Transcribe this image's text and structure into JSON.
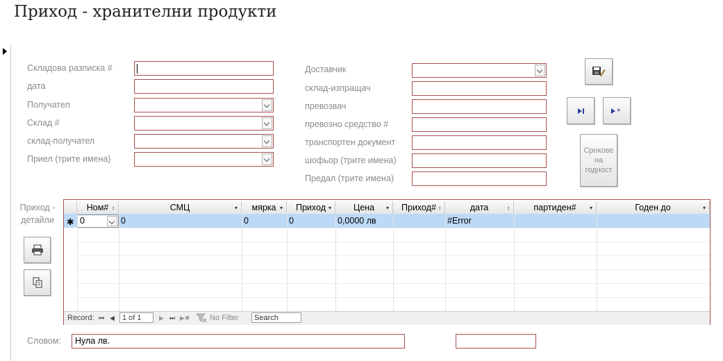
{
  "window": {
    "title": "Приход - хранителни продукти"
  },
  "left_fields": [
    {
      "label": "Складова разписка #",
      "value": "",
      "type": "text"
    },
    {
      "label": "дата",
      "value": "",
      "type": "text"
    },
    {
      "label": "Получател",
      "value": "",
      "type": "combo"
    },
    {
      "label": "Склад #",
      "value": "",
      "type": "combo"
    },
    {
      "label": "склад-получател",
      "value": "",
      "type": "combo"
    },
    {
      "label": "Приел (трите имена)",
      "value": "",
      "type": "combo"
    }
  ],
  "right_fields": [
    {
      "label": "Доставчик",
      "value": "",
      "type": "combo"
    },
    {
      "label": "склад-изпращач",
      "value": "",
      "type": "text"
    },
    {
      "label": "превозвач",
      "value": "",
      "type": "text"
    },
    {
      "label": "превозно средство #",
      "value": "",
      "type": "text"
    },
    {
      "label": "транспортен документ",
      "value": "",
      "type": "text"
    },
    {
      "label": "шофьор (трите имена)",
      "value": "",
      "type": "text"
    },
    {
      "label": "Предал (трите имена)",
      "value": "",
      "type": "text"
    }
  ],
  "buttons": {
    "shelf_life_line1": "Срокове",
    "shelf_life_line2": "на",
    "shelf_life_line3": "годност",
    "save_icon": "save-edit-icon",
    "last_record_icon": "last-record-icon",
    "new_record_icon": "new-record-icon",
    "print_icon": "print-icon",
    "copy_icon": "copy-icon"
  },
  "details": {
    "label_line1": "Приход -",
    "label_line2": "детайли",
    "columns": [
      {
        "label": "Ном#",
        "sort": "↕"
      },
      {
        "label": "СМЦ",
        "sort": "▾"
      },
      {
        "label": "мярка",
        "sort": "▾"
      },
      {
        "label": "Приход",
        "sort": "▾"
      },
      {
        "label": "Цена",
        "sort": "▾"
      },
      {
        "label": "Приход#",
        "sort": "↕"
      },
      {
        "label": "дата",
        "sort": "↕"
      },
      {
        "label": "партиден#",
        "sort": "▾"
      },
      {
        "label": "Годен до",
        "sort": "▾"
      }
    ],
    "new_row_marker": "✱",
    "new_row": [
      "0",
      "0",
      "0",
      "0",
      "0,0000 лв",
      "",
      "#Error",
      "",
      ""
    ]
  },
  "record_nav": {
    "label": "Record:",
    "first": "⏮",
    "prev": "◀",
    "current": "1 of 1",
    "next": "▶",
    "last": "⏭",
    "new": "▶✱",
    "filter_icon": "filter-off-icon",
    "filter": "No Filter",
    "search": "Search"
  },
  "footer": {
    "words_label": "Словом:",
    "words_value": "Нула лв.",
    "extra_value": ""
  },
  "colors": {
    "border_accent": "#a85050",
    "row_highlight": "#bcd9f7",
    "label_gray": "#8a8a8a"
  }
}
